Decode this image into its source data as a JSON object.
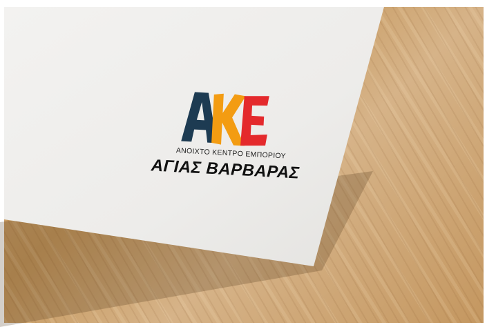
{
  "logo": {
    "letters": [
      "Α",
      "Κ",
      "Ε"
    ],
    "letter_colors": [
      "#1d3b52",
      "#f39c12",
      "#e4292c"
    ],
    "tagline": "ΑΝΟΙΧΤΟ ΚΕΝΤΡΟ ΕΜΠΟΡΙΟΥ",
    "name": "ΑΓΙΑΣ ΒΑΡΒΑΡΑΣ"
  },
  "scene": {
    "paper_color": "#efeeec",
    "wood_color": "#c99d68"
  }
}
